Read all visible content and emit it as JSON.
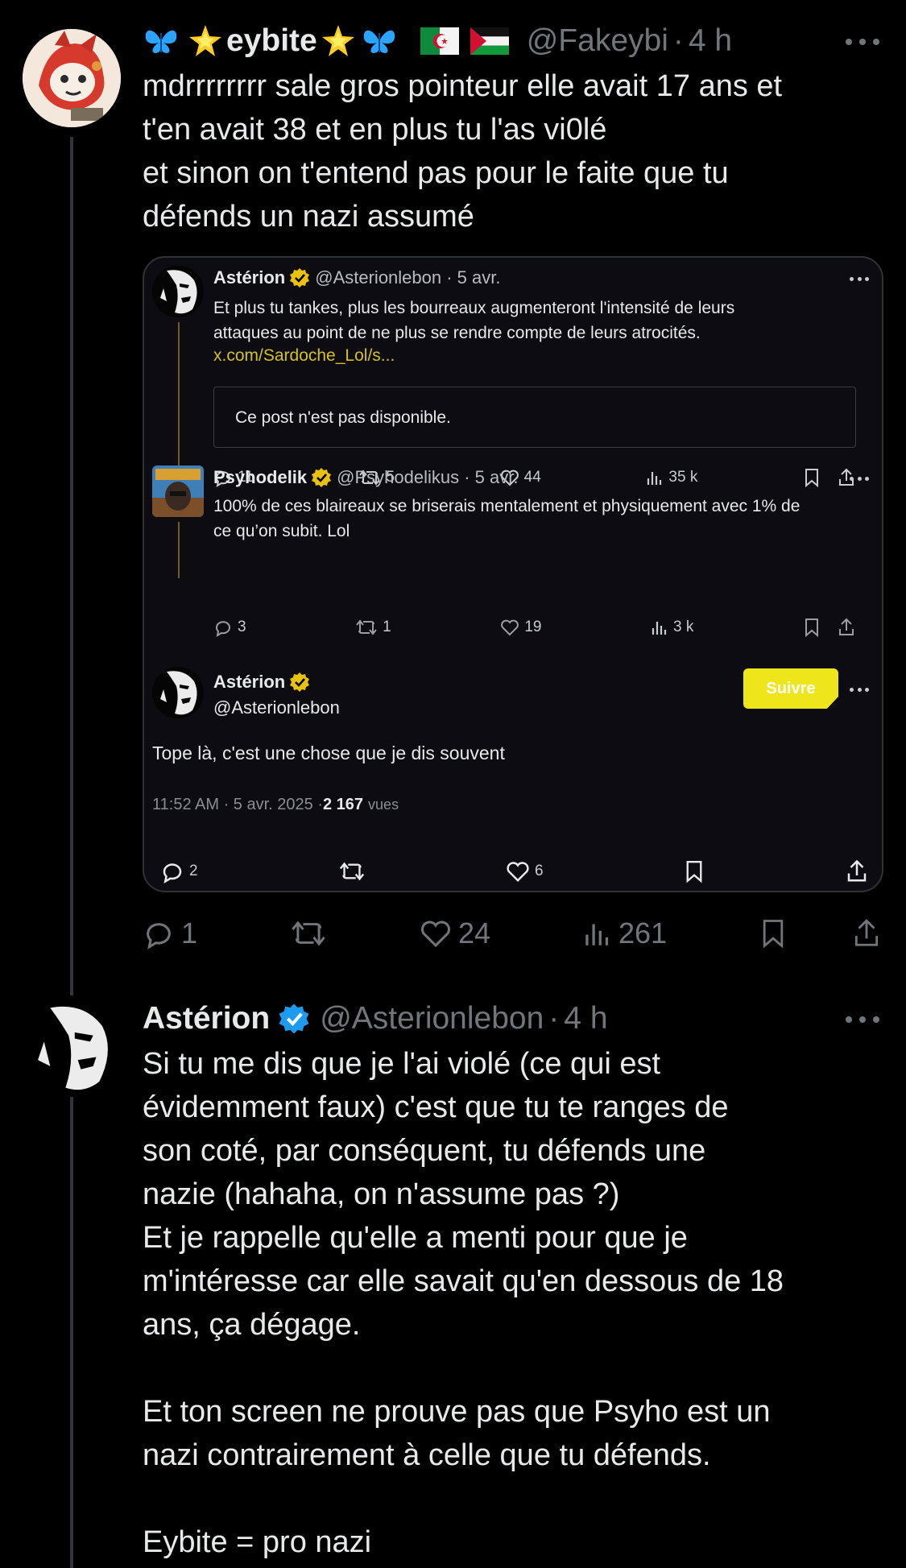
{
  "tweet1": {
    "name": "eybite",
    "handle": "@Fakeybi",
    "time": "4 h",
    "text": "mdrrrrrrrr sale gros pointeur elle avait 17 ans et\nt'en avait 38 et en plus tu l'as vi0lé\net sinon on t'entend pas pour le faite que tu\ndéfends un nazi assumé",
    "replies": "1",
    "likes": "24",
    "views": "261"
  },
  "quote": {
    "post1": {
      "name": "Astérion",
      "sub": "@Asterionlebon · 5 avr.",
      "text": "Et plus tu tankes, plus les bourreaux augmenteront l'intensité de leurs\nattaques au point de ne plus se rendre compte de leurs atrocités.",
      "link": "x.com/Sardoche_Lol/s...",
      "unavailable": "Ce post n'est pas disponible.",
      "replies": "11",
      "reposts": "5",
      "likes": "44",
      "views": "35 k"
    },
    "post2": {
      "name": "Psyhodelik",
      "sub": "@Psyhodelikus · 5 avr.",
      "text": "100% de ces blaireaux se briserais mentalement et physiquement  avec 1% de\nce qu’on subit. Lol",
      "replies": "3",
      "reposts": "1",
      "likes": "19",
      "views": "3 k"
    },
    "post3": {
      "name": "Astérion",
      "handle": "@Asterionlebon",
      "follow_label": "Suivre",
      "text": "Tope là, c'est une chose que je dis souvent",
      "meta_time": "11:52 AM · 5 avr. 2025 · ",
      "meta_views": "2 167",
      "meta_views_label": "vues",
      "replies": "2",
      "likes": "6"
    }
  },
  "tweet2": {
    "name": "Astérion",
    "handle": "@Asterionlebon",
    "time": "4 h",
    "text": "Si tu me dis que je l'ai violé (ce qui est\névidemment faux) c'est que tu te ranges de\nson coté, par conséquent, tu défends une\nnazie (hahaha, on n'assume pas ?)\nEt je rappelle qu'elle a menti pour que je\nm'intéresse car elle savait qu'en dessous de 18\nans, ça dégage.\n\nEt ton screen ne prouve pas que Psyho est un\nnazi contrairement à celle que tu défends.\n\nEybite = pro nazi"
  },
  "colors": {
    "background": "#000000",
    "text": "#e7e9ea",
    "muted": "#71767b",
    "verified_blue": "#1d9bf0",
    "verified_gold": "#e8c20c",
    "follow_yellow": "#eee51a"
  },
  "icons": [
    "butterfly-icon",
    "star-icon",
    "flag-algeria-icon",
    "flag-palestine-icon",
    "reply-icon",
    "repost-icon",
    "like-icon",
    "views-icon",
    "bookmark-icon",
    "share-icon",
    "verified-badge-icon",
    "more-icon"
  ]
}
